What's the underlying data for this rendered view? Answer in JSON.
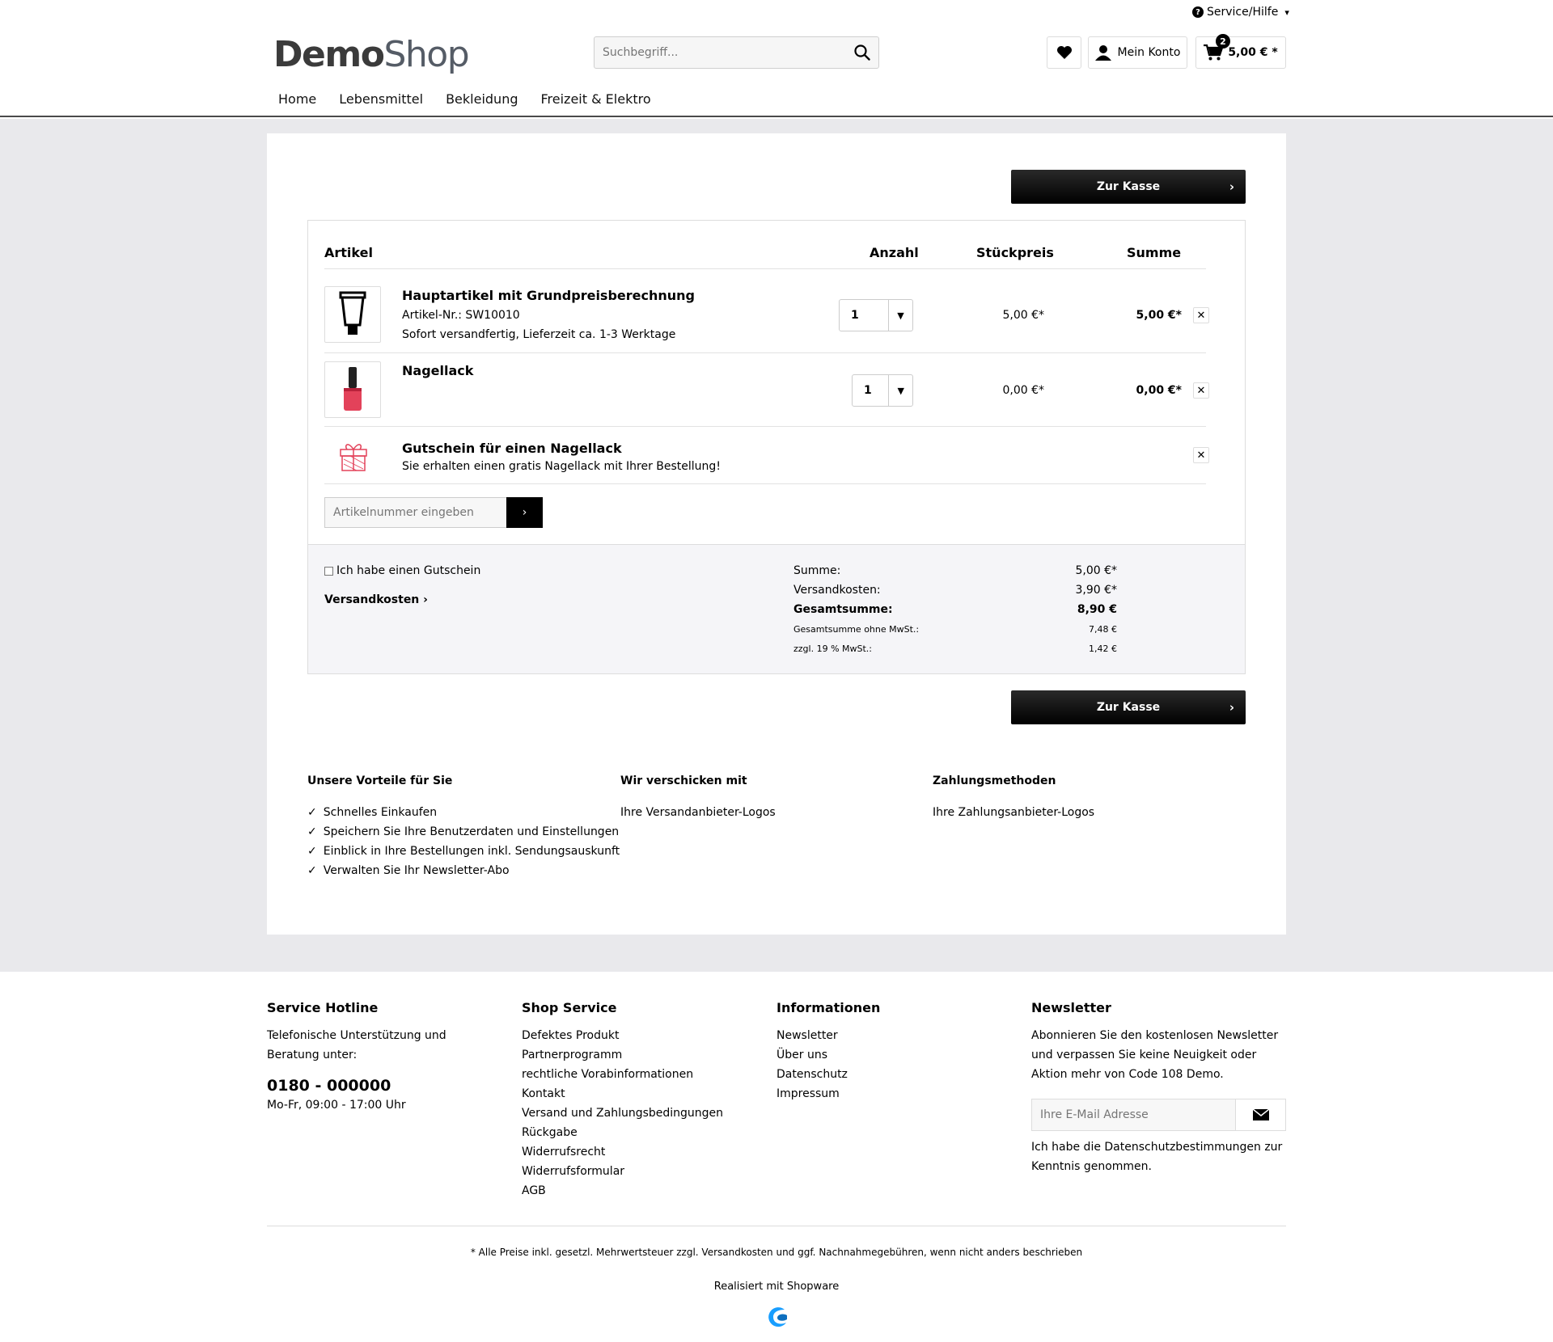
{
  "header": {
    "service_label": "Service/Hilfe",
    "logo_part1": "Demo",
    "logo_part2": "Shop",
    "search_placeholder": "Suchbegriff...",
    "account_label": "Mein Konto",
    "cart_count": "2",
    "cart_total": "5,00 € *",
    "nav": [
      "Home",
      "Lebensmittel",
      "Bekleidung",
      "Freizeit & Elektro"
    ]
  },
  "cart": {
    "checkout_label": "Zur Kasse",
    "col_article": "Artikel",
    "col_qty": "Anzahl",
    "col_unit": "Stückpreis",
    "col_sum": "Summe",
    "items": [
      {
        "title": "Hauptartikel mit Grundpreisberechnung",
        "sku": "Artikel-Nr.: SW10010",
        "delivery": "Sofort versandfertig, Lieferzeit ca. 1-3 Werktage",
        "qty": "1",
        "unit_price": "5,00 €*",
        "sum": "5,00 €*"
      },
      {
        "title": "Nagellack",
        "qty": "1",
        "unit_price": "0,00 €*",
        "sum": "0,00 €*"
      },
      {
        "title": "Gutschein für einen Nagellack",
        "desc": "Sie erhalten einen gratis Nagellack mit Ihrer Bestellung!"
      }
    ],
    "article_placeholder": "Artikelnummer eingeben",
    "voucher_label": "Ich habe einen Gutschein",
    "shipping_link": "Versandkosten",
    "summary": {
      "sum_label": "Summe:",
      "sum_value": "5,00 €*",
      "ship_label": "Versandkosten:",
      "ship_value": "3,90 €*",
      "total_label": "Gesamtsumme:",
      "total_value": "8,90 €",
      "net_label": "Gesamtsumme ohne MwSt.:",
      "net_value": "7,48 €",
      "vat_label": "zzgl. 19 % MwSt.:",
      "vat_value": "1,42 €"
    }
  },
  "advantages": {
    "title": "Unsere Vorteile für Sie",
    "items": [
      "Schnelles Einkaufen",
      "Speichern Sie Ihre Benutzerdaten und Einstellungen",
      "Einblick in Ihre Bestellungen inkl. Sendungsauskunft",
      "Verwalten Sie Ihr Newsletter-Abo"
    ],
    "shipping_title": "Wir verschicken mit",
    "shipping_text": "Ihre Versandanbieter-Logos",
    "payment_title": "Zahlungsmethoden",
    "payment_text": "Ihre Zahlungsanbieter-Logos"
  },
  "footer": {
    "hotline_title": "Service Hotline",
    "hotline_text": "Telefonische Unterstützung und Beratung unter:",
    "hotline_number": "0180 - 000000",
    "hotline_hours": "Mo-Fr, 09:00 - 17:00 Uhr",
    "shop_service_title": "Shop Service",
    "shop_service": [
      "Defektes Produkt",
      "Partnerprogramm",
      "rechtliche Vorabinformationen",
      "Kontakt",
      "Versand und Zahlungsbedingungen",
      "Rückgabe",
      "Widerrufsrecht",
      "Widerrufsformular",
      "AGB"
    ],
    "info_title": "Informationen",
    "info": [
      "Newsletter",
      "Über uns",
      "Datenschutz",
      "Impressum"
    ],
    "newsletter_title": "Newsletter",
    "newsletter_text": "Abonnieren Sie den kostenlosen Newsletter und verpassen Sie keine Neuigkeit oder Aktion mehr von Code 108 Demo.",
    "email_placeholder": "Ihre E-Mail Adresse",
    "privacy_text": "Ich habe die Datenschutzbestimmungen zur Kenntnis genommen.",
    "vat_note": "* Alle Preise inkl. gesetzl. Mehrwertsteuer zzgl. Versandkosten und ggf. Nachnahmegebühren, wenn nicht anders beschrieben",
    "realized": "Realisiert mit Shopware"
  },
  "colors": {
    "accent_blue": "#189eff",
    "gift_red": "#e3425a",
    "main_bg": "#e9e9ec"
  }
}
